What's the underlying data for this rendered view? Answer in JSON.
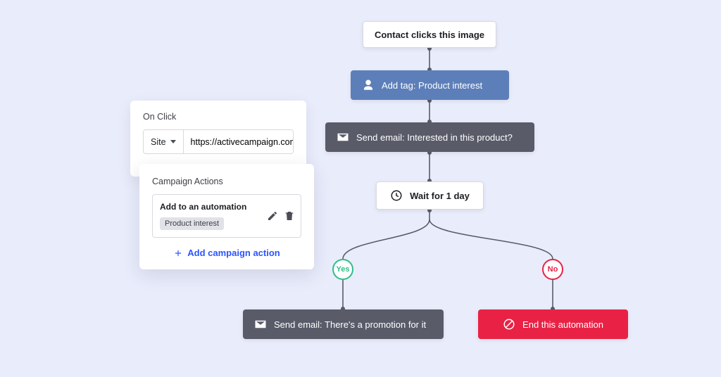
{
  "onclick": {
    "label": "On Click",
    "select": "Site",
    "url": "https://activecampaign.com"
  },
  "campaign_actions": {
    "label": "Campaign Actions",
    "item_title": "Add to an automation",
    "item_tag": "Product interest",
    "add_link": "Add campaign action"
  },
  "flow": {
    "trigger": "Contact clicks this image",
    "tag": "Add tag: Product interest",
    "email1": "Send email: Interested in this product?",
    "wait": "Wait for 1 day",
    "yes": "Yes",
    "no": "No",
    "email2": "Send email: There's a promotion for it",
    "end": "End this automation"
  },
  "colors": {
    "bg": "#e9ecfb",
    "blue": "#5d7fb9",
    "dark": "#595b69",
    "red": "#e92245",
    "green": "#2fbf8a",
    "link": "#2a54ff"
  }
}
